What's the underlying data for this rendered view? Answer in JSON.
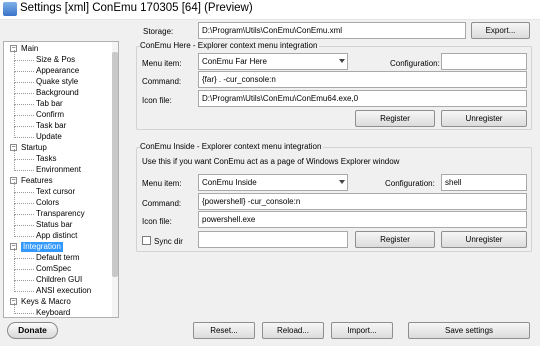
{
  "window": {
    "title": "Settings [xml] ConEmu 170305 [64] (Preview)"
  },
  "storage": {
    "label": "Storage:",
    "path": "D:\\Program\\Utils\\ConEmu\\ConEmu.xml",
    "export_button": "Export..."
  },
  "tree": {
    "items": [
      {
        "label": "Main",
        "level": 0,
        "expanded": true
      },
      {
        "label": "Size & Pos",
        "level": 1
      },
      {
        "label": "Appearance",
        "level": 1
      },
      {
        "label": "Quake style",
        "level": 1
      },
      {
        "label": "Background",
        "level": 1
      },
      {
        "label": "Tab bar",
        "level": 1
      },
      {
        "label": "Confirm",
        "level": 1
      },
      {
        "label": "Task bar",
        "level": 1
      },
      {
        "label": "Update",
        "level": 1
      },
      {
        "label": "Startup",
        "level": 0,
        "expanded": true
      },
      {
        "label": "Tasks",
        "level": 1
      },
      {
        "label": "Environment",
        "level": 1
      },
      {
        "label": "Features",
        "level": 0,
        "expanded": true
      },
      {
        "label": "Text cursor",
        "level": 1
      },
      {
        "label": "Colors",
        "level": 1
      },
      {
        "label": "Transparency",
        "level": 1
      },
      {
        "label": "Status bar",
        "level": 1
      },
      {
        "label": "App distinct",
        "level": 1
      },
      {
        "label": "Integration",
        "level": 0,
        "expanded": true,
        "selected": true
      },
      {
        "label": "Default term",
        "level": 1
      },
      {
        "label": "ComSpec",
        "level": 1
      },
      {
        "label": "Children GUI",
        "level": 1
      },
      {
        "label": "ANSI execution",
        "level": 1
      },
      {
        "label": "Keys & Macro",
        "level": 0,
        "expanded": true
      },
      {
        "label": "Keyboard",
        "level": 1
      }
    ]
  },
  "here_group": {
    "title": "ConEmu Here - Explorer context menu integration",
    "menu_item_label": "Menu item:",
    "menu_item_value": "ConEmu Far Here",
    "configuration_label": "Configuration:",
    "configuration_value": "",
    "command_label": "Command:",
    "command_value": "{far} . -cur_console:n",
    "icon_label": "Icon file:",
    "icon_value": "D:\\Program\\Utils\\ConEmu\\ConEmu64.exe,0",
    "register_button": "Register",
    "unregister_button": "Unregister"
  },
  "inside_group": {
    "title": "ConEmu Inside - Explorer context menu integration",
    "description": "Use this if you want ConEmu act as a page of Windows Explorer window",
    "menu_item_label": "Menu item:",
    "menu_item_value": "ConEmu Inside",
    "configuration_label": "Configuration:",
    "configuration_value": "shell",
    "command_label": "Command:",
    "command_value": "{powershell} -cur_console:n",
    "icon_label": "Icon file:",
    "icon_value": "powershell.exe",
    "sync_dir_label": "Sync dir",
    "sync_dir_checked": false,
    "sync_dir_value": "",
    "register_button": "Register",
    "unregister_button": "Unregister"
  },
  "footer": {
    "donate_button": "Donate",
    "reset_button": "Reset...",
    "reload_button": "Reload...",
    "import_button": "Import...",
    "save_button": "Save settings"
  }
}
